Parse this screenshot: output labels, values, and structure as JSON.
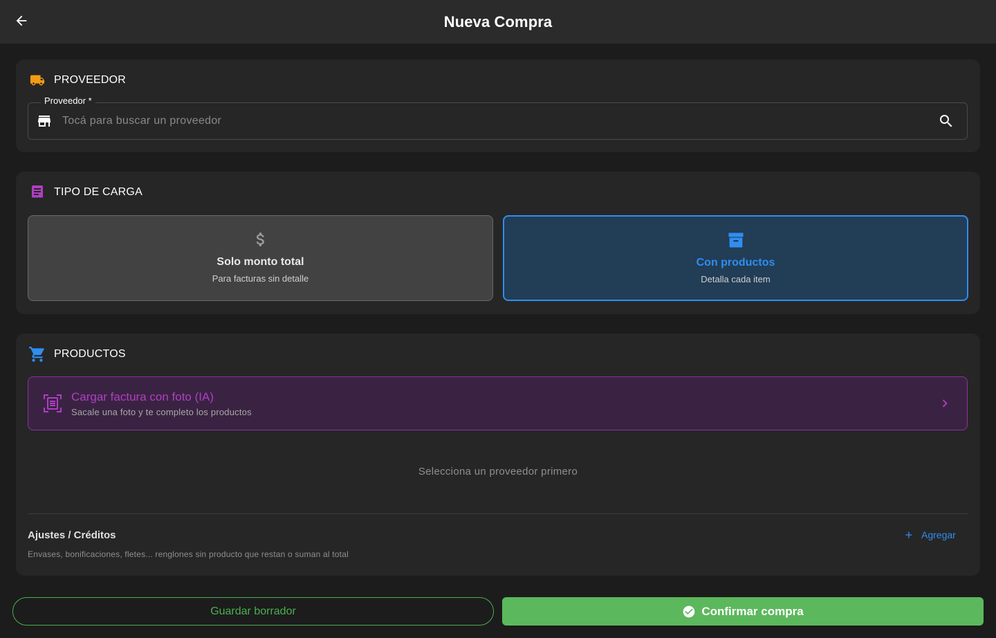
{
  "header": {
    "title": "Nueva Compra",
    "back_icon": "arrow-back-icon"
  },
  "supplier": {
    "section_title": "PROVEEDOR",
    "section_icon": "truck-icon",
    "field_label": "Proveedor *",
    "placeholder": "Tocá para buscar un proveedor",
    "value": "",
    "leading_icon": "store-icon",
    "trailing_icon": "search-icon"
  },
  "load_type": {
    "section_title": "TIPO DE CARGA",
    "section_icon": "receipt-icon",
    "options": [
      {
        "title": "Solo monto total",
        "subtitle": "Para facturas sin detalle",
        "icon": "dollar-icon",
        "selected": false
      },
      {
        "title": "Con productos",
        "subtitle": "Detalla cada item",
        "icon": "archive-box-icon",
        "selected": true
      }
    ]
  },
  "products": {
    "section_title": "PRODUCTOS",
    "section_icon": "cart-icon",
    "ai_banner": {
      "title": "Cargar factura con foto (IA)",
      "subtitle": "Sacale una foto y te completo los productos",
      "icon": "document-scan-icon",
      "chevron": "chevron-right-icon"
    },
    "empty_message": "Selecciona un proveedor primero",
    "adjustments": {
      "title": "Ajustes / Créditos",
      "subtitle": "Envases, bonificaciones, fletes... renglones sin producto que restan o suman al total",
      "add_label": "Agregar",
      "add_icon": "plus-icon"
    }
  },
  "actions": {
    "draft_label": "Guardar borrador",
    "confirm_label": "Confirmar compra",
    "confirm_icon": "check-circle-icon"
  },
  "colors": {
    "background": "#1c1c1c",
    "card": "#262626",
    "appbar": "#2b2b2b",
    "accent_blue": "#2f8ef0",
    "accent_purple": "#b03ec4",
    "truck_orange": "#f39c12",
    "success_green": "#5cb85c"
  }
}
